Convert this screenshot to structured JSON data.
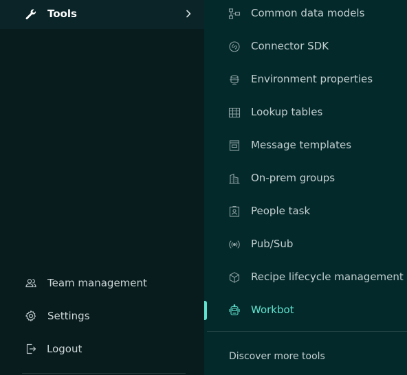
{
  "sidebar": {
    "tools_label": "Tools",
    "bottom_items": [
      {
        "label": "Team management",
        "icon": "people-icon"
      },
      {
        "label": "Settings",
        "icon": "gear-icon"
      },
      {
        "label": "Logout",
        "icon": "logout-icon"
      }
    ]
  },
  "tools_menu": {
    "items": [
      {
        "label": "Common data models",
        "icon": "data-model-icon"
      },
      {
        "label": "Connector SDK",
        "icon": "connector-icon"
      },
      {
        "label": "Environment properties",
        "icon": "environment-icon"
      },
      {
        "label": "Lookup tables",
        "icon": "table-icon"
      },
      {
        "label": "Message templates",
        "icon": "template-icon"
      },
      {
        "label": "On-prem groups",
        "icon": "building-icon"
      },
      {
        "label": "People task",
        "icon": "person-badge-icon"
      },
      {
        "label": "Pub/Sub",
        "icon": "broadcast-icon"
      },
      {
        "label": "Recipe lifecycle management",
        "icon": "cube-icon"
      },
      {
        "label": "Workbot",
        "icon": "robot-icon",
        "active": true
      }
    ],
    "discover_label": "Discover more tools"
  },
  "colors": {
    "sidebar_bg": "#081b1d",
    "panel_bg": "#04292a",
    "accent": "#5fe3cf",
    "text": "#c3cfd0"
  }
}
